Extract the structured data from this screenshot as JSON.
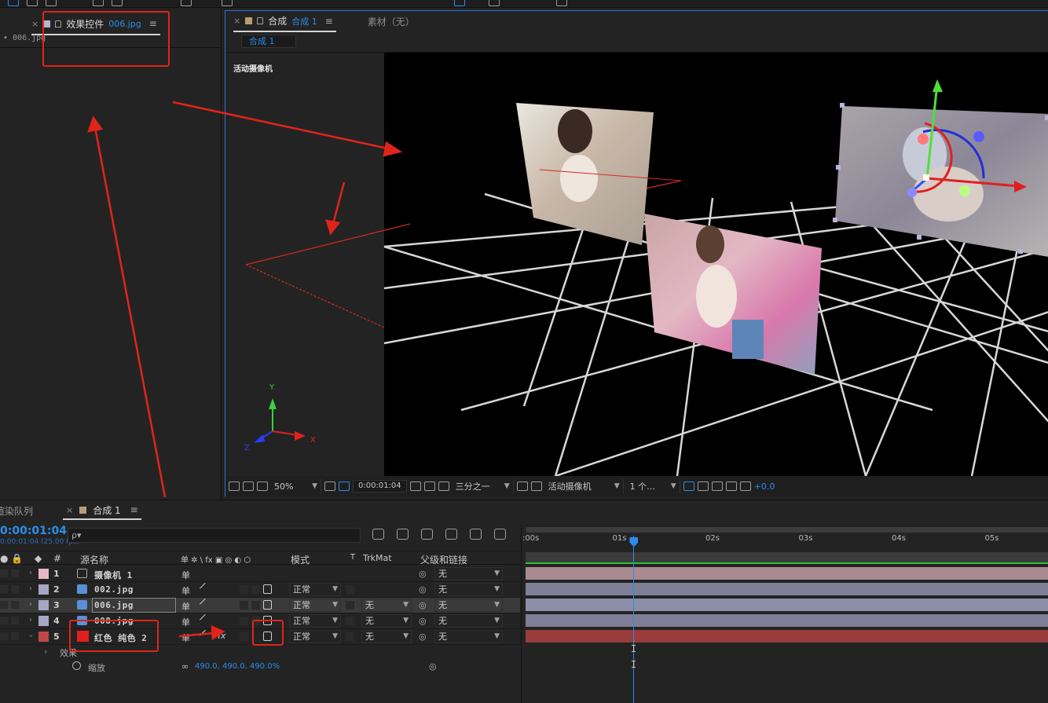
{
  "colors": {
    "accent_blue": "#2d8ceb",
    "annotation_red": "#e0241b",
    "panel_bg": "#232323",
    "viewer_bg": "#000000",
    "label_camera": "#e6b7c4",
    "label_footage": "#a6a6c6",
    "label_solid": "#c04848",
    "solid_swatch": "#e21f1f",
    "timeline_green": "#29c23a"
  },
  "effect_controls": {
    "tab_title": "效果控件",
    "tab_target": "006.jpg",
    "subtitle": "• 006.jpg",
    "menu_icon": "hamburger-icon"
  },
  "composition": {
    "tab_prefix": "合成",
    "tab_name": "合成 1",
    "footage_label": "素材（无）",
    "breadcrumb": "合成 1",
    "camera_label": "活动摄像机",
    "axis_labels": {
      "x": "X",
      "y": "Y",
      "z": "Z"
    },
    "viewer_bar": {
      "zoom": "50%",
      "timecode": "0:00:01:04",
      "grid_mode": "三分之一",
      "view": "活动摄像机",
      "views_count": "1 个…",
      "exposure": "+0.0"
    }
  },
  "timeline": {
    "render_queue_tab": "渲染队列",
    "comp_tab": "合成 1",
    "timecode": "0:00:01:04",
    "fps": "0:00:01:04 (25.00 fps)",
    "search_placeholder": "ρ▾",
    "columns": {
      "number": "#",
      "source_name": "源名称",
      "switches": "单 ✲ \\ fx ▣ ◎ ◐ ⬡",
      "mode": "模式",
      "t": "T",
      "trkmat": "TrkMat",
      "parent": "父级和链接"
    },
    "layers": [
      {
        "num": "1",
        "name": "摄像机 1",
        "type": "camera",
        "mode": "",
        "trkmat": "",
        "parent": "无"
      },
      {
        "num": "2",
        "name": "002.jpg",
        "type": "footage",
        "mode": "正常",
        "trkmat": "",
        "parent": "无"
      },
      {
        "num": "3",
        "name": "006.jpg",
        "type": "footage",
        "mode": "正常",
        "trkmat": "无",
        "parent": "无"
      },
      {
        "num": "4",
        "name": "008.jpg",
        "type": "footage",
        "mode": "正常",
        "trkmat": "无",
        "parent": "无"
      },
      {
        "num": "5",
        "name": "红色 纯色 2",
        "type": "solid",
        "mode": "正常",
        "trkmat": "无",
        "parent": "无"
      }
    ],
    "effects_label": "效果",
    "scale_label": "缩放",
    "scale_value": "490.0, 490.0, 490.0%",
    "ruler_ticks": [
      ":00s",
      "01s",
      "02s",
      "03s",
      "04s",
      "05s"
    ],
    "current_time_seconds": 1.16
  }
}
